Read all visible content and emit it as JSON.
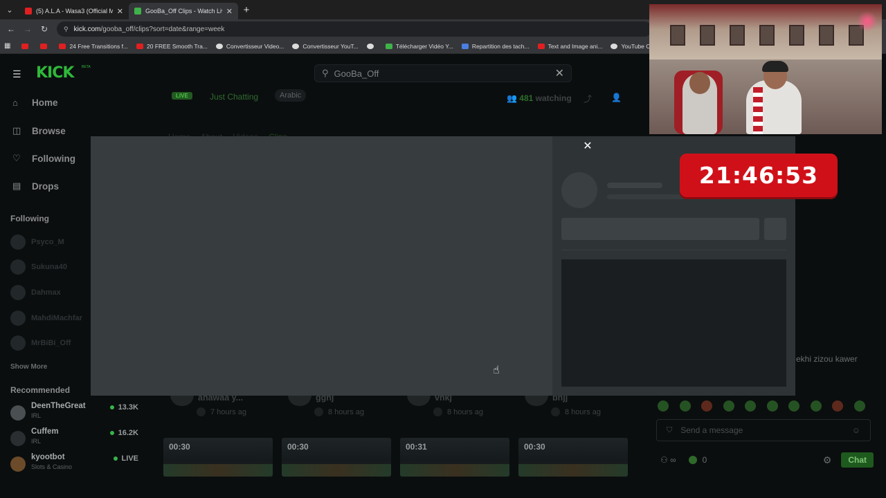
{
  "browser": {
    "tabs": [
      {
        "title": "(5) A.L.A - Wasa3 (Official Music",
        "favicon_color": "#e02020",
        "active": false
      },
      {
        "title": "GooBa_Off Clips - Watch Live o",
        "favicon_color": "#3fb24a",
        "active": true
      }
    ],
    "url_host": "kick.com",
    "url_path": "/gooba_off/clips?sort=date&range=week",
    "bookmarks": [
      {
        "label": "",
        "icon": "youtube-icon"
      },
      {
        "label": "",
        "icon": "youtube-icon"
      },
      {
        "label": "24 Free Transitions f...",
        "icon": "youtube-icon"
      },
      {
        "label": "20 FREE Smooth Tra...",
        "icon": "youtube-icon"
      },
      {
        "label": "Convertisseur Video...",
        "icon": "globe-icon"
      },
      {
        "label": "Convertisseur YouT...",
        "icon": "globe-icon"
      },
      {
        "label": "",
        "icon": "globe-icon"
      },
      {
        "label": "Télécharger Vidéo Y...",
        "icon": "download-icon"
      },
      {
        "label": "Repartition des tach...",
        "icon": "doc-icon"
      },
      {
        "label": "Text and Image ani...",
        "icon": "youtube-icon"
      },
      {
        "label": "YouTube Converter...",
        "icon": "globe-icon"
      }
    ]
  },
  "kick": {
    "logo": "KICK",
    "logo_badge": "BETA",
    "search_value": "GooBa_Off",
    "nav": [
      {
        "label": "Home",
        "icon": "home-icon"
      },
      {
        "label": "Browse",
        "icon": "compass-icon"
      },
      {
        "label": "Following",
        "icon": "heart-icon"
      },
      {
        "label": "Drops",
        "icon": "gift-icon"
      }
    ],
    "following_heading": "Following",
    "following": [
      "Psyco_M",
      "Sukuna40",
      "Dahmax",
      "MahdiMachfar",
      "MrBiBi_Off"
    ],
    "show_more": "Show More",
    "recommended_heading": "Recommended",
    "recommended": [
      {
        "name": "DeenTheGreat",
        "category": "IRL",
        "viewers": "13.3K"
      },
      {
        "name": "Cuffem",
        "category": "IRL",
        "viewers": "16.2K"
      },
      {
        "name": "kyootbot",
        "category": "Slots & Casino",
        "viewers": "LIVE"
      }
    ],
    "stream": {
      "live_badge": "LIVE",
      "category": "Just Chatting",
      "tag": "Arabic",
      "watching_count": "481",
      "watching_label": "watching"
    },
    "page_tabs": [
      "Home",
      "About",
      "Videos",
      "Clips"
    ],
    "clips": [
      {
        "title": "ahawaa y...",
        "ago": "7 hours ag",
        "duration": "00:30"
      },
      {
        "title": "gghj",
        "ago": "8 hours ag",
        "duration": "00:30"
      },
      {
        "title": "vhkj",
        "ago": "8 hours ag",
        "duration": "00:31"
      },
      {
        "title": "bhjj",
        "ago": "8 hours ag",
        "duration": "00:30"
      }
    ],
    "chat": {
      "last_message": "ekhi zizou kawer",
      "input_placeholder": "Send a message",
      "points": "0",
      "chat_button": "Chat"
    }
  },
  "modal": {
    "close_label": "✕"
  },
  "overlay": {
    "timer": "21:46:53",
    "timer_color": "#d01019"
  }
}
